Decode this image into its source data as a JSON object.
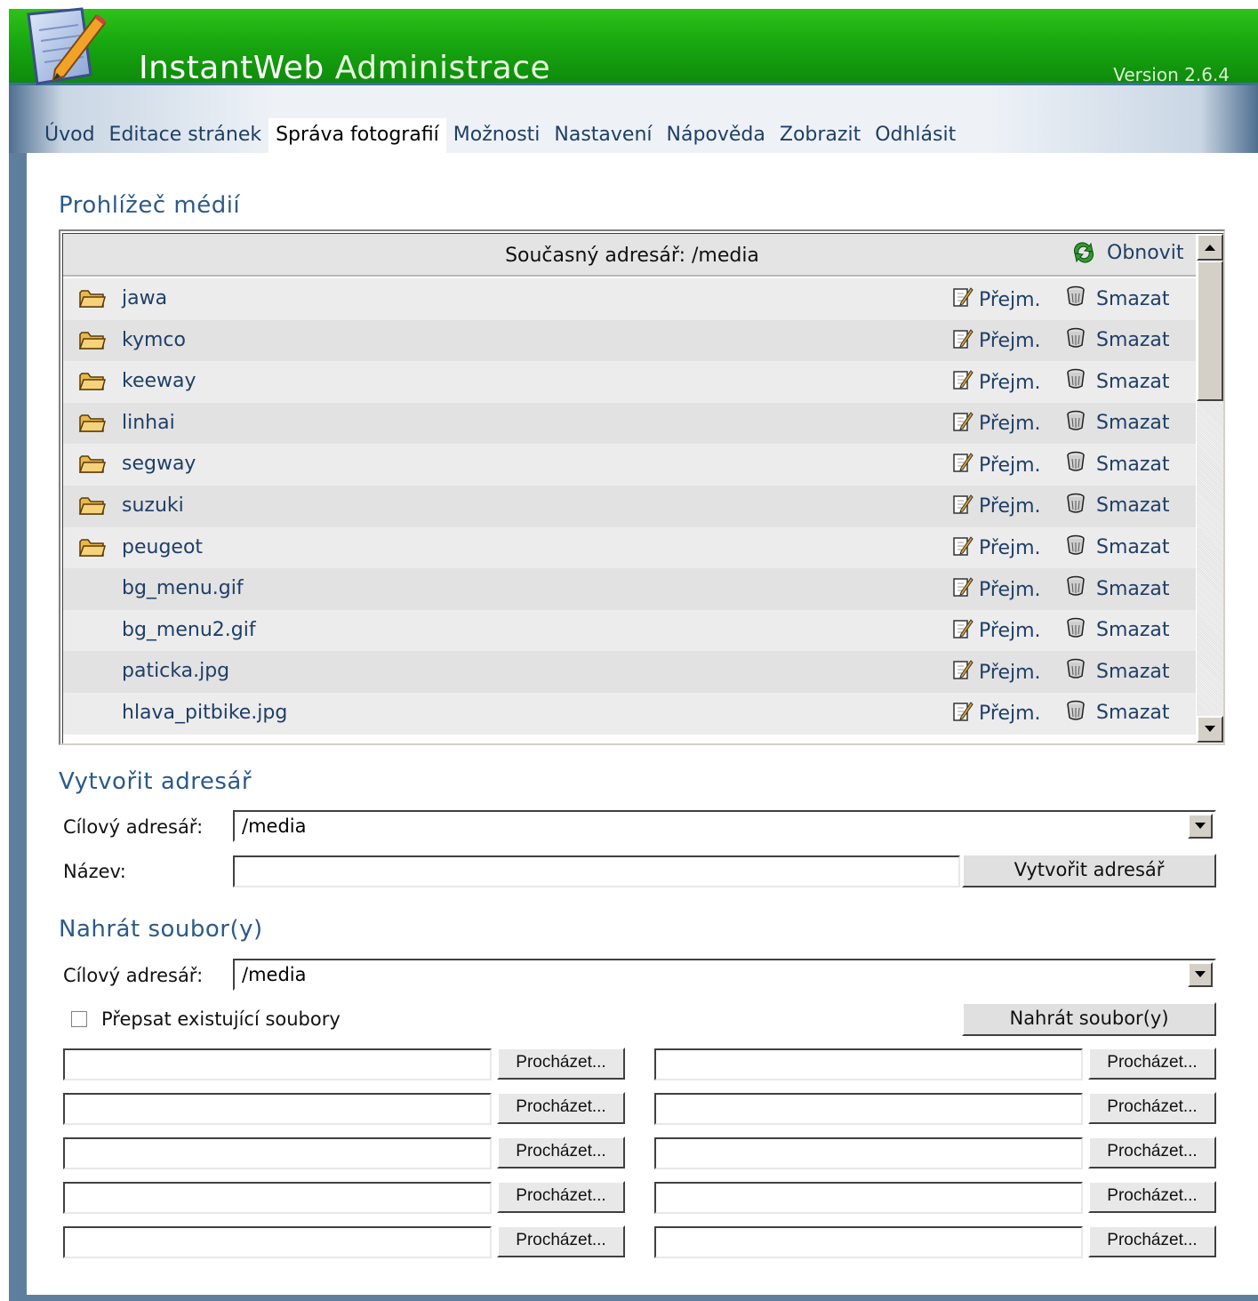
{
  "header": {
    "title_part1": "InstantWeb",
    "title_part2": " Administrace",
    "version": "Version 2.6.4"
  },
  "nav": {
    "items": [
      {
        "label": "Úvod",
        "active": false
      },
      {
        "label": "Editace stránek",
        "active": false
      },
      {
        "label": "Správa fotografií",
        "active": true
      },
      {
        "label": "Možnosti",
        "active": false
      },
      {
        "label": "Nastavení",
        "active": false
      },
      {
        "label": "Nápověda",
        "active": false
      },
      {
        "label": "Zobrazit",
        "active": false
      },
      {
        "label": "Odhlásit",
        "active": false
      }
    ]
  },
  "media_browser": {
    "title": "Prohlížeč médií",
    "current_dir_label": "Současný adresář: /media",
    "refresh_label": "Obnovit",
    "rename_label": "Přejm.",
    "delete_label": "Smazat",
    "items": [
      {
        "name": "jawa",
        "type": "folder"
      },
      {
        "name": "kymco",
        "type": "folder"
      },
      {
        "name": "keeway",
        "type": "folder"
      },
      {
        "name": "linhai",
        "type": "folder"
      },
      {
        "name": "segway",
        "type": "folder"
      },
      {
        "name": "suzuki",
        "type": "folder"
      },
      {
        "name": "peugeot",
        "type": "folder"
      },
      {
        "name": "bg_menu.gif",
        "type": "file"
      },
      {
        "name": "bg_menu2.gif",
        "type": "file"
      },
      {
        "name": "paticka.jpg",
        "type": "file"
      },
      {
        "name": "hlava_pitbike.jpg",
        "type": "file"
      }
    ]
  },
  "create_dir": {
    "title": "Vytvořit adresář",
    "target_label": "Cílový adresář:",
    "target_value": "/media",
    "name_label": "Název:",
    "name_value": "",
    "button_label": "Vytvořit adresář"
  },
  "upload": {
    "title": "Nahrát soubor(y)",
    "target_label": "Cílový adresář:",
    "target_value": "/media",
    "overwrite_label": "Přepsat existující soubory",
    "overwrite_checked": false,
    "button_label": "Nahrát soubor(y)",
    "browse_label": "Procházet...",
    "file_slots": 10
  },
  "colors": {
    "header_green": "#18a810",
    "link_blue": "#1f3f66",
    "section_title": "#2c5a8a"
  }
}
